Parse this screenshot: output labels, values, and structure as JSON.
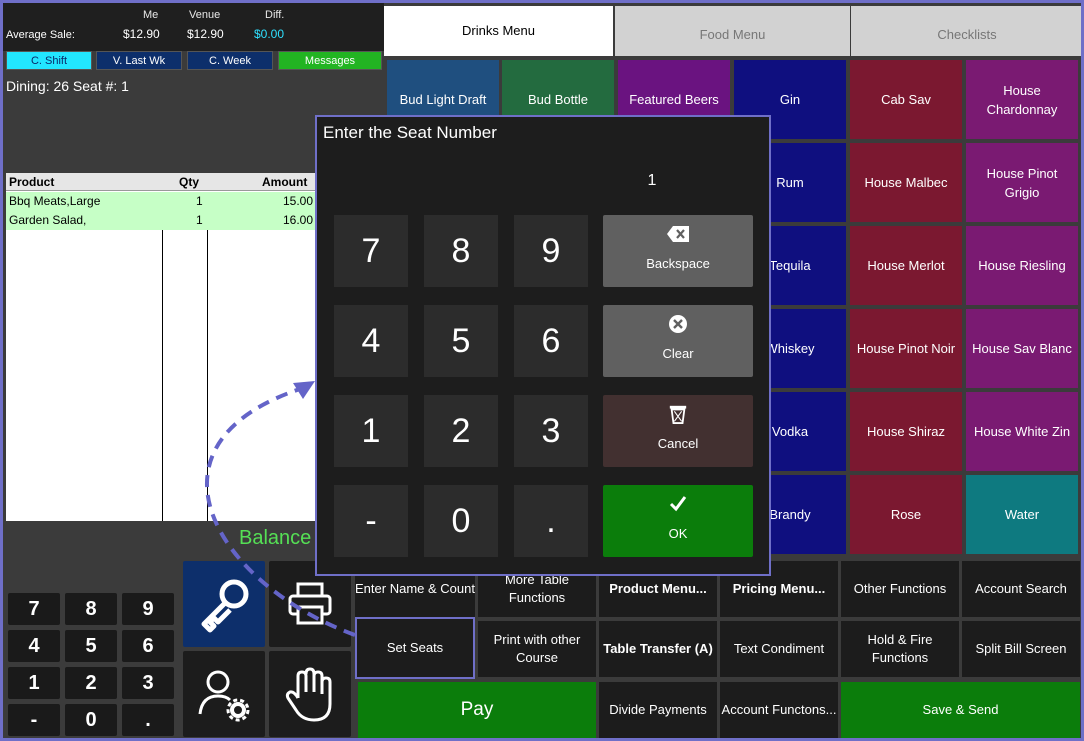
{
  "stats": {
    "average_sale_label": "Average Sale:",
    "col_me": "Me",
    "col_venue": "Venue",
    "col_diff": "Diff.",
    "me_value": "$12.90",
    "venue_value": "$12.90",
    "diff_value": "$0.00"
  },
  "period_buttons": [
    "C. Shift",
    "V. Last Wk",
    "C. Week"
  ],
  "messages_label": "Messages",
  "info_line": "Dining: 26  Seat #: 1",
  "order_table": {
    "headers": [
      "Product",
      "Qty",
      "Amount"
    ],
    "rows": [
      {
        "product": "Bbq Meats,Large",
        "qty": "1",
        "amount": "15.00"
      },
      {
        "product": "Garden Salad,",
        "qty": "1",
        "amount": "16.00"
      }
    ]
  },
  "balance_label": "Balance",
  "left_keypad": [
    "7",
    "8",
    "9",
    "4",
    "5",
    "6",
    "1",
    "2",
    "3",
    "-",
    "0",
    "."
  ],
  "tabs": [
    "Drinks Menu",
    "Food Menu",
    "Checklists"
  ],
  "menu_items": [
    "Bud Light Draft",
    "Bud Bottle",
    "Featured Beers",
    "Gin",
    "Cab Sav",
    "House Chardonnay",
    "Rum",
    "House Malbec",
    "House Pinot Grigio",
    "Tequila",
    "House Merlot",
    "House Riesling",
    "Whiskey",
    "House Pinot Noir",
    "House Sav Blanc",
    "Vodka",
    "House Shiraz",
    "House White Zin",
    "Brandy",
    "Rose",
    "Water"
  ],
  "function_buttons": {
    "enter_name": "Enter Name & Count",
    "more_table": "More Table Functions",
    "product_menu": "Product Menu...",
    "pricing_menu": "Pricing Menu...",
    "other_functions": "Other Functions",
    "account_search": "Account Search",
    "set_seats": "Set Seats",
    "print_course": "Print with other Course",
    "table_transfer": "Table Transfer (A)",
    "text_condiment": "Text Condiment",
    "hold_fire": "Hold & Fire Functions",
    "split_bill": "Split Bill Screen",
    "pay": "Pay",
    "divide_payments": "Divide Payments",
    "account_functions": "Account Functons...",
    "save_send": "Save & Send"
  },
  "dialog": {
    "title": "Enter the Seat Number",
    "value": "1",
    "keys": [
      "7",
      "8",
      "9",
      "4",
      "5",
      "6",
      "1",
      "2",
      "3",
      "-",
      "0",
      "."
    ],
    "backspace": "Backspace",
    "clear": "Clear",
    "cancel": "Cancel",
    "ok": "OK"
  },
  "colors": {
    "accent_border": "#6f6fc8",
    "ok_green": "#0b7d0b",
    "shift_cyan": "#22e6ff",
    "messages_green": "#22b422",
    "balance_green": "#55e055",
    "diff_cyan": "#2fe0ff"
  }
}
